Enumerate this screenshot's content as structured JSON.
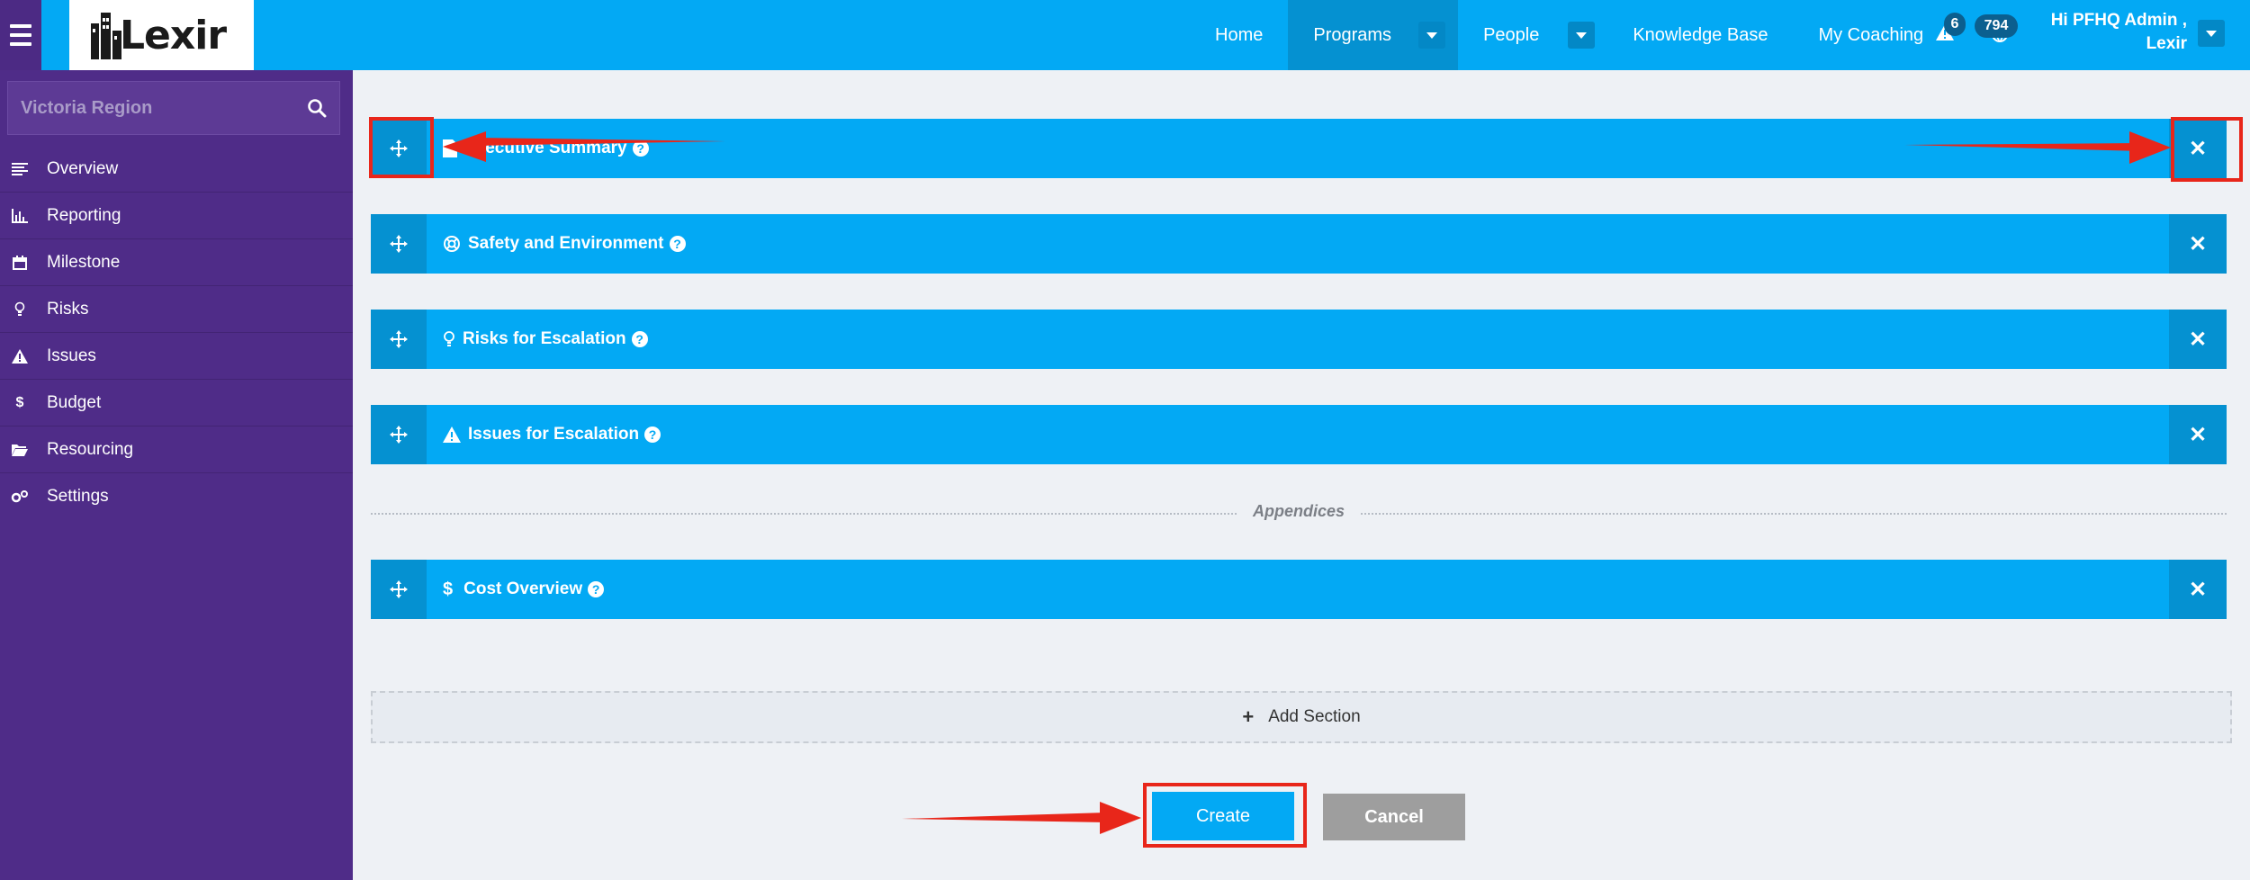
{
  "brand": {
    "logo_text": "Lexir"
  },
  "nav": {
    "home": "Home",
    "programs": "Programs",
    "people": "People",
    "knowledge_base": "Knowledge Base",
    "my_coaching": "My Coaching"
  },
  "alerts": {
    "warnings_count": "6",
    "notifications_count": "794"
  },
  "user": {
    "greeting_line1": "Hi PFHQ Admin ,",
    "greeting_line2": "Lexir"
  },
  "sidebar": {
    "search_value": "Victoria Region",
    "items": [
      {
        "label": "Overview",
        "icon": "list-icon"
      },
      {
        "label": "Reporting",
        "icon": "bar-chart-icon"
      },
      {
        "label": "Milestone",
        "icon": "calendar-icon"
      },
      {
        "label": "Risks",
        "icon": "lightbulb-icon"
      },
      {
        "label": "Issues",
        "icon": "warning-icon"
      },
      {
        "label": "Budget",
        "icon": "dollar-icon"
      },
      {
        "label": "Resourcing",
        "icon": "folder-icon"
      },
      {
        "label": "Settings",
        "icon": "cogs-icon"
      }
    ]
  },
  "sections": [
    {
      "title": "Executive Summary",
      "icon": "document-icon"
    },
    {
      "title": "Safety and Environment",
      "icon": "lifebuoy-icon"
    },
    {
      "title": "Risks for Escalation",
      "icon": "lightbulb-icon"
    },
    {
      "title": "Issues for Escalation",
      "icon": "warning-icon"
    }
  ],
  "appendix": {
    "label": "Appendices",
    "sections": [
      {
        "title": "Cost Overview",
        "icon": "dollar-icon"
      }
    ]
  },
  "actions": {
    "add_section": "Add Section",
    "create": "Create",
    "cancel": "Cancel"
  },
  "colors": {
    "topbar": "#03a9f4",
    "sidebar": "#4f2c88",
    "section_bar": "#03a9f4",
    "cancel": "#9e9e9e",
    "annotation": "#e8261a"
  }
}
